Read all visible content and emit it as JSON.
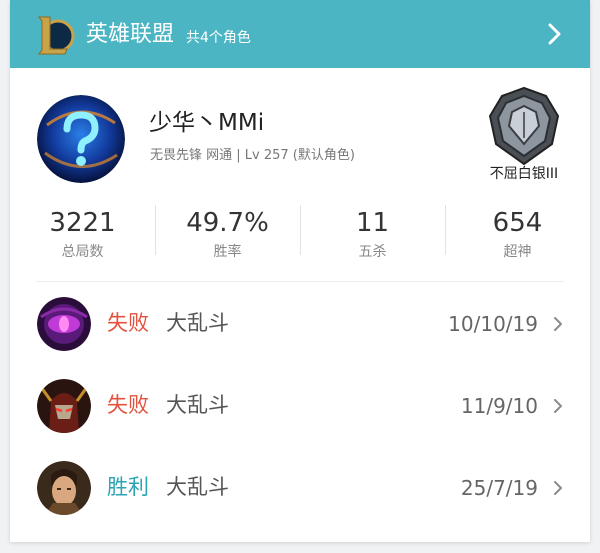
{
  "header": {
    "title": "英雄联盟",
    "subtitle": "共4个角色",
    "logo_icon": "league-of-legends-logo",
    "chevron_icon": "chevron-right-icon",
    "bg_color": "#4cb5c4"
  },
  "profile": {
    "name": "少华丶MMi",
    "info": "无畏先锋 网通 | Lv 257 (默认角色)",
    "avatar_icon": "question-mark-orb-avatar",
    "rank_icon": "silver-rank-emblem",
    "rank": "不屈白银III"
  },
  "stats": [
    {
      "value": "3221",
      "label": "总局数"
    },
    {
      "value": "49.7%",
      "label": "胜率"
    },
    {
      "value": "11",
      "label": "五杀"
    },
    {
      "value": "654",
      "label": "超神"
    }
  ],
  "matches": [
    {
      "result": "失败",
      "mode": "大乱斗",
      "date": "10/10/19",
      "champion_icon": "purple-eye-champion-portrait",
      "result_color": "#e2533f"
    },
    {
      "result": "失败",
      "mode": "大乱斗",
      "date": "11/9/10",
      "champion_icon": "red-masked-champion-portrait",
      "result_color": "#e2533f"
    },
    {
      "result": "胜利",
      "mode": "大乱斗",
      "date": "25/7/19",
      "champion_icon": "warrior-champion-portrait",
      "result_color": "#2aa3b3"
    }
  ]
}
